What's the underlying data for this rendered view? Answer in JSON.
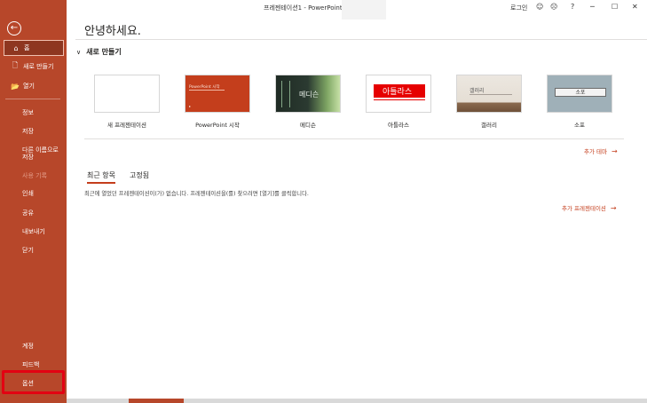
{
  "app": {
    "title": "프레젠테이션1 - PowerPoint",
    "sign_in": "로그인",
    "help": "?",
    "minimize": "─",
    "maximize": "☐",
    "close": "✕",
    "emoji_smile": "☺",
    "emoji_sad": "☹"
  },
  "sidebar": {
    "back_icon": "←",
    "home": "홈",
    "home_icon": "⌂",
    "new": "새로 만들기",
    "new_icon": "🗋",
    "open": "열기",
    "open_icon": "📂",
    "info": "정보",
    "save": "저장",
    "save_as_line1": "다른 이름으로",
    "save_as_line2": "저장",
    "history": "사용 기록",
    "print": "인쇄",
    "share": "공유",
    "export": "내보내기",
    "close": "닫기",
    "account": "계정",
    "feedback": "피드백",
    "options": "옵션",
    "accent_color": "#b7472a",
    "highlight_color": "#e30012"
  },
  "main": {
    "greeting": "안녕하세요.",
    "new_section": "새로 만들기",
    "templates": [
      {
        "label": "새 프레젠테이션"
      },
      {
        "label": "PowerPoint 시작",
        "thumb_title": "PowerPoint 시작"
      },
      {
        "label": "메디슨",
        "thumb_title": "메디슨"
      },
      {
        "label": "아틀라스",
        "thumb_title": "아틀라스"
      },
      {
        "label": "갤러리",
        "thumb_title": "갤러리"
      },
      {
        "label": "소포",
        "thumb_title": "소포"
      }
    ],
    "more_themes": "추가 테마",
    "tabs": [
      "최근 항목",
      "고정됨"
    ],
    "recent_empty_message": "최근에 열었던 프레젠테이션이(가) 없습니다. 프레젠테이션을(를) 찾으려면 [열기]를 클릭합니다.",
    "more_presentations": "추가 프레젠테이션",
    "arrow": "→"
  }
}
